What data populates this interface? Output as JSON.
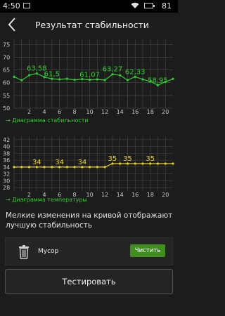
{
  "status_bar": {
    "time": "4:50",
    "battery": "81",
    "icons": [
      "image-icon",
      "wifi-icon",
      "battery-icon"
    ]
  },
  "header": {
    "title": "Результат стабильности",
    "back_icon": "chevron-left-icon"
  },
  "stability_chart": {
    "legend": "Диаграмма стабильности",
    "color": "#2fd02f",
    "y_ticks": [
      "75",
      "70",
      "65",
      "60",
      "55",
      "50"
    ],
    "x_ticks": [
      "2",
      "4",
      "6",
      "8",
      "10",
      "12",
      "14",
      "16",
      "18",
      "20"
    ],
    "labels": [
      "63,58",
      "61,5",
      "61,07",
      "63,27",
      "62,33",
      "58,95"
    ]
  },
  "temperature_chart": {
    "legend": "Диаграмма температуры",
    "color": "#e8d21e",
    "y_ticks": [
      "42",
      "40",
      "38",
      "36",
      "34",
      "32",
      "30",
      "28"
    ],
    "x_ticks": [
      "2",
      "4",
      "6",
      "8",
      "10",
      "12",
      "14",
      "16",
      "18",
      "20"
    ],
    "labels": [
      "34",
      "34",
      "34",
      "35",
      "35",
      "35"
    ]
  },
  "chart_data": [
    {
      "type": "line",
      "title": "",
      "series": [
        {
          "name": "Диаграмма стабильности",
          "x": [
            0,
            1,
            2,
            3,
            4,
            5,
            6,
            7,
            8,
            9,
            10,
            11,
            12,
            13,
            14,
            15,
            16,
            17,
            18,
            19,
            20,
            21
          ],
          "values": [
            62.3,
            60.9,
            62.9,
            63.6,
            62.2,
            61.5,
            61.3,
            61.5,
            61.1,
            61.4,
            61.1,
            61.3,
            61.0,
            63.3,
            62.9,
            61.0,
            62.3,
            61.3,
            60.5,
            59.0,
            60.3,
            61.5
          ]
        }
      ],
      "xlabel": "",
      "ylabel": "",
      "ylim": [
        50,
        77
      ],
      "xlim": [
        0,
        21
      ],
      "grid": true,
      "legend": "bottom-left"
    },
    {
      "type": "line",
      "title": "",
      "series": [
        {
          "name": "Диаграмма температуры",
          "x": [
            0,
            1,
            2,
            3,
            4,
            5,
            6,
            7,
            8,
            9,
            10,
            11,
            12,
            13,
            14,
            15,
            16,
            17,
            18,
            19,
            20,
            21
          ],
          "values": [
            34,
            34,
            34,
            34,
            34,
            34,
            34,
            34,
            34,
            34,
            34,
            34,
            34,
            35,
            35,
            35,
            35,
            35,
            35,
            35,
            35,
            35
          ]
        }
      ],
      "xlabel": "",
      "ylabel": "",
      "ylim": [
        27,
        43
      ],
      "xlim": [
        0,
        21
      ],
      "grid": true,
      "legend": "bottom-left"
    }
  ],
  "note": "Мелкие изменения на кривой отображают лучшую стабильность",
  "trash": {
    "label": "Мусор",
    "button": "Чистить",
    "icon": "trash-icon",
    "button_color": "#3f8e1e"
  },
  "test_button": "Тестировать"
}
